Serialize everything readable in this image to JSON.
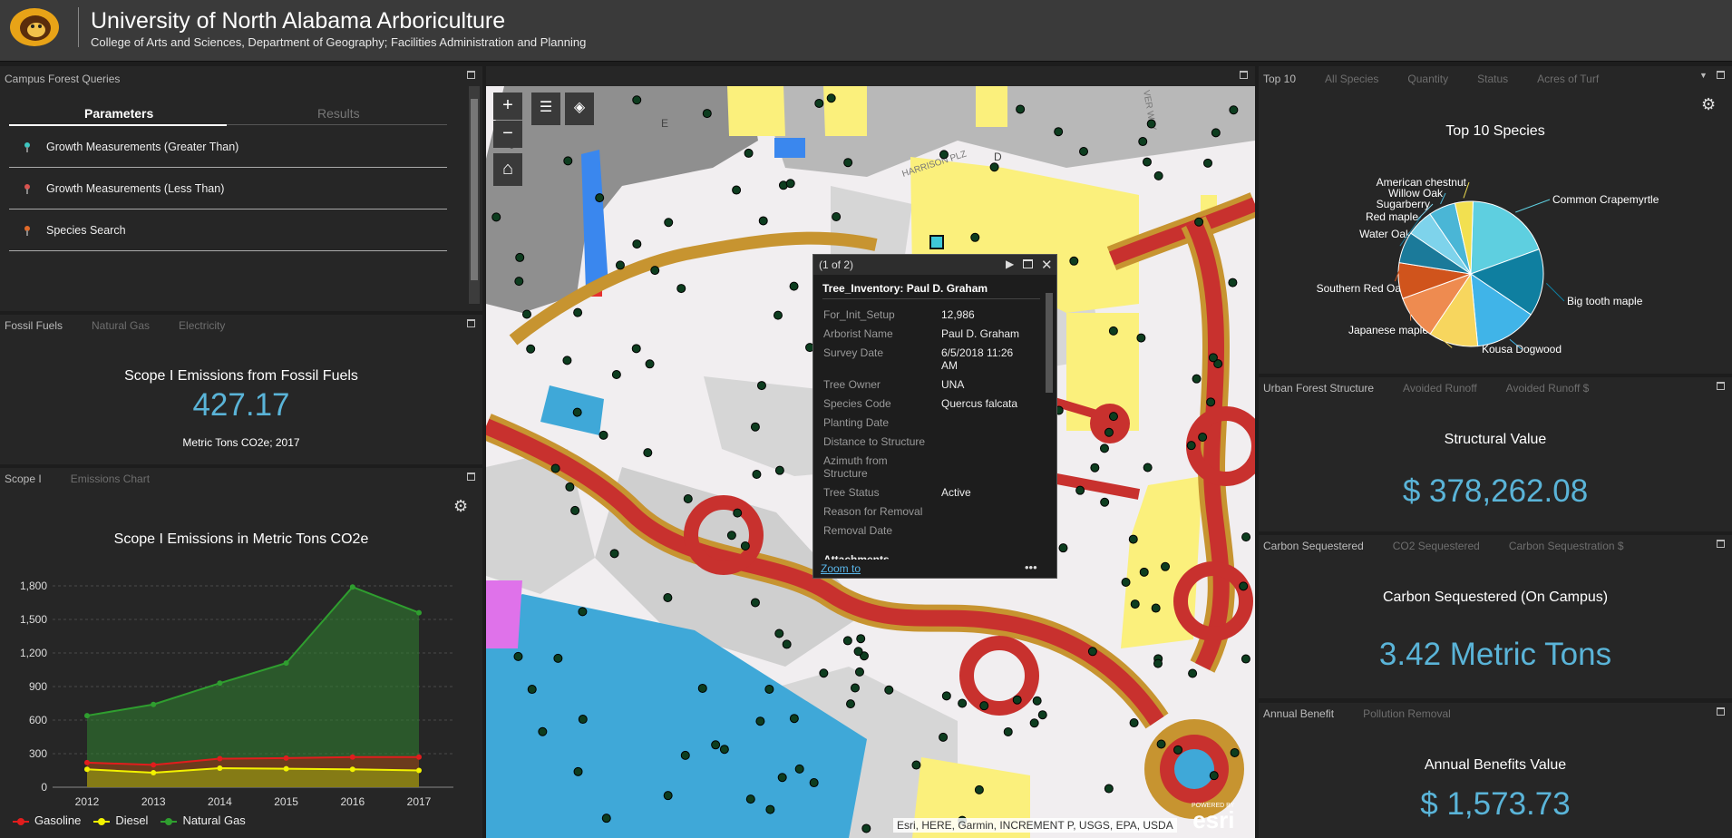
{
  "header": {
    "title": "University of North Alabama Arboriculture",
    "subtitle": "College of Arts and Sciences, Department of Geography; Facilities Administration and Planning"
  },
  "queries_panel": {
    "title": "Campus Forest Queries",
    "tab_parameters": "Parameters",
    "tab_results": "Results",
    "items": [
      {
        "label": "Growth Measurements (Greater Than)",
        "pin_color": "#3ec6c0"
      },
      {
        "label": "Growth Measurements (Less Than)",
        "pin_color": "#d9534f"
      },
      {
        "label": "Species Search",
        "pin_color": "#e06a2a"
      }
    ]
  },
  "fossil_panel": {
    "tabs": [
      "Fossil Fuels",
      "Natural Gas",
      "Electricity"
    ],
    "title": "Scope I Emissions from Fossil Fuels",
    "value": "427.17",
    "unit": "Metric Tons CO2e; 2017"
  },
  "emissions_panel": {
    "tabs": [
      "Scope I",
      "Emissions Chart"
    ],
    "legend": [
      {
        "name": "Gasoline",
        "color": "#e11d1d"
      },
      {
        "name": "Diesel",
        "color": "#f2f200"
      },
      {
        "name": "Natural Gas",
        "color": "#2f9e2f"
      }
    ]
  },
  "chart_data": [
    {
      "type": "area",
      "title": "Scope I Emissions in Metric Tons CO2e",
      "x": [
        "2012",
        "2013",
        "2014",
        "2015",
        "2016",
        "2017"
      ],
      "ylim": [
        0,
        1800
      ],
      "yticks": [
        "0",
        "300",
        "600",
        "900",
        "1,200",
        "1,500",
        "1,800"
      ],
      "grid": true,
      "legend_position": "bottom",
      "series": [
        {
          "name": "Natural Gas",
          "color": "#2f9e2f",
          "values": [
            640,
            740,
            930,
            1110,
            1790,
            1560
          ]
        },
        {
          "name": "Gasoline",
          "color": "#e11d1d",
          "values": [
            220,
            200,
            255,
            260,
            270,
            270
          ]
        },
        {
          "name": "Diesel",
          "color": "#f2f200",
          "values": [
            160,
            130,
            170,
            165,
            160,
            150
          ]
        }
      ]
    },
    {
      "type": "pie",
      "title": "Top 10 Species",
      "categories": [
        "Common Crapemyrtle",
        "Big tooth maple",
        "Kousa Dogwood",
        "Japanese maple",
        "Southern Red Oak",
        "Water Oak",
        "Red maple",
        "Sugarberry",
        "Willow Oak",
        "American chestnut"
      ],
      "values": [
        19,
        15,
        14,
        11,
        10,
        8,
        7,
        6,
        6,
        4
      ],
      "colors": [
        "#5ecfe0",
        "#0f7fa0",
        "#40b4e8",
        "#f7d65e",
        "#ee8b50",
        "#d0541c",
        "#1b7a9a",
        "#7ed3eb",
        "#4ab6d6",
        "#f2e050"
      ]
    }
  ],
  "map": {
    "popup": {
      "pager": "(1 of 2)",
      "title": "Tree_Inventory: Paul D. Graham",
      "fields": [
        {
          "label": "For_Init_Setup",
          "value": "12,986"
        },
        {
          "label": "Arborist Name",
          "value": "Paul D. Graham"
        },
        {
          "label": "Survey Date",
          "value": "6/5/2018 11:26 AM"
        },
        {
          "label": "Tree Owner",
          "value": "UNA"
        },
        {
          "label": "Species Code",
          "value": "Quercus falcata"
        },
        {
          "label": "Planting Date",
          "value": ""
        },
        {
          "label": "Distance to Structure",
          "value": ""
        },
        {
          "label": "Azimuth from Structure",
          "value": ""
        },
        {
          "label": "Tree Status",
          "value": "Active"
        },
        {
          "label": "Reason for Removal",
          "value": ""
        },
        {
          "label": "Removal Date",
          "value": ""
        }
      ],
      "next_label": "Attachments",
      "zoom_to": "Zoom to"
    },
    "labels": [
      "E",
      "D",
      "HARRISON PLZ",
      "VER WAY"
    ],
    "attribution": "Esri, HERE, Garmin, INCREMENT P, USGS, EPA, USDA",
    "esri_powered": "POWERED BY",
    "esri_logo": "esri"
  },
  "species_panel": {
    "tabs": [
      "Top 10",
      "All Species",
      "Quantity",
      "Status",
      "Acres of Turf"
    ]
  },
  "structure_panel": {
    "tabs": [
      "Urban Forest Structure",
      "Avoided Runoff",
      "Avoided Runoff $"
    ],
    "title": "Structural Value",
    "value": "$ 378,262.08"
  },
  "carbon_panel": {
    "tabs": [
      "Carbon Sequestered",
      "CO2 Sequestered",
      "Carbon Sequestration $"
    ],
    "title": "Carbon Sequestered (On Campus)",
    "value": "3.42 Metric Tons"
  },
  "benefit_panel": {
    "tabs": [
      "Annual Benefit",
      "Pollution Removal"
    ],
    "title": "Annual Benefits Value",
    "value": "$ 1,573.73"
  }
}
